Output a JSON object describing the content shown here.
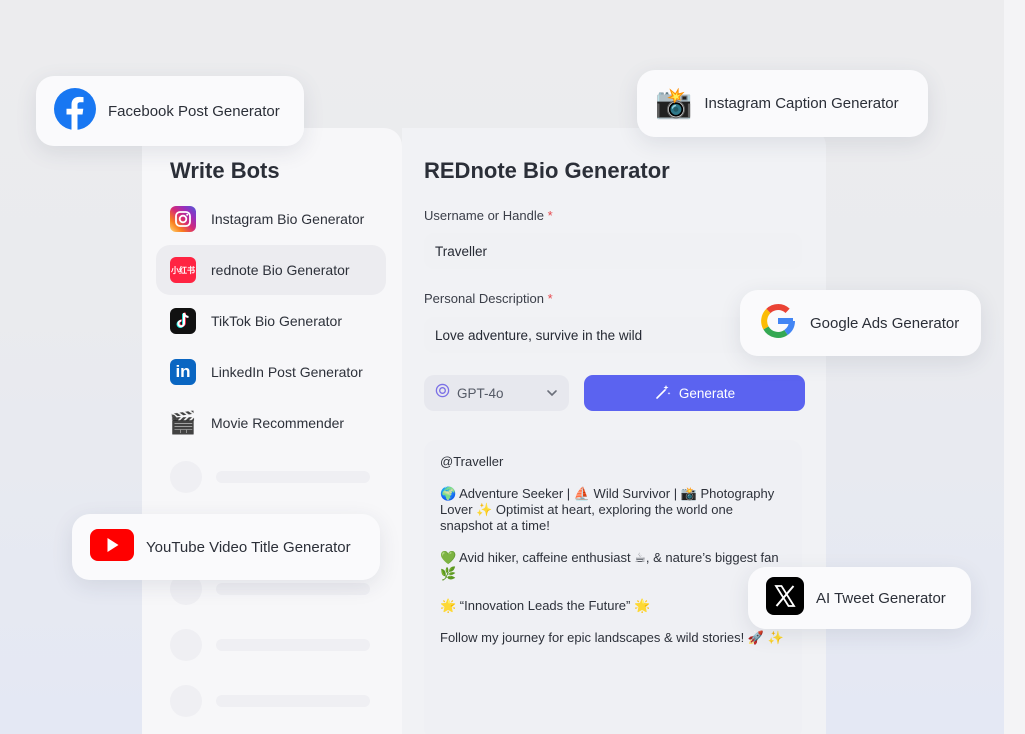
{
  "sidebar": {
    "title": "Write Bots",
    "items": [
      {
        "label": "Instagram Bio Generator",
        "icon": "instagram-icon"
      },
      {
        "label": "rednote Bio Generator",
        "icon": "rednote-icon",
        "icon_text": "小红书"
      },
      {
        "label": "TikTok Bio Generator",
        "icon": "tiktok-icon"
      },
      {
        "label": "LinkedIn Post Generator",
        "icon": "linkedin-icon",
        "icon_text": "in"
      },
      {
        "label": "Movie Recommender",
        "icon": "clapperboard-icon",
        "icon_text": "🎬"
      }
    ]
  },
  "main": {
    "title": "REDnote Bio Generator",
    "username_label": "Username or Handle",
    "username_value": "Traveller",
    "description_label": "Personal Description",
    "description_value": "Love adventure, survive in the wild",
    "required_mark": "*",
    "model": "GPT-4o",
    "generate_label": "Generate",
    "output": [
      "@Traveller",
      "🌍 Adventure Seeker | ⛵ Wild Survivor | 📸 Photography Lover ✨ Optimist at heart, exploring the world one snapshot at a time!",
      "💚 Avid hiker, caffeine enthusiast ☕, & nature’s biggest fan 🌿",
      "🌟 “Innovation Leads the Future” 🌟",
      "Follow my journey for epic landscapes & wild stories! 🚀 ✨"
    ]
  },
  "chips": {
    "facebook": "Facebook Post Generator",
    "instagram_caption": "Instagram Caption Generator",
    "instagram_caption_icon": "📸",
    "google_ads": "Google Ads Generator",
    "youtube": "YouTube Video Title Generator",
    "tweet": "AI Tweet Generator"
  },
  "colors": {
    "accent": "#5b63f0",
    "required": "#e5484d",
    "facebook": "#1877f2",
    "youtube": "#ff0000",
    "rednote": "#ff2442",
    "linkedin": "#0a66c2"
  }
}
